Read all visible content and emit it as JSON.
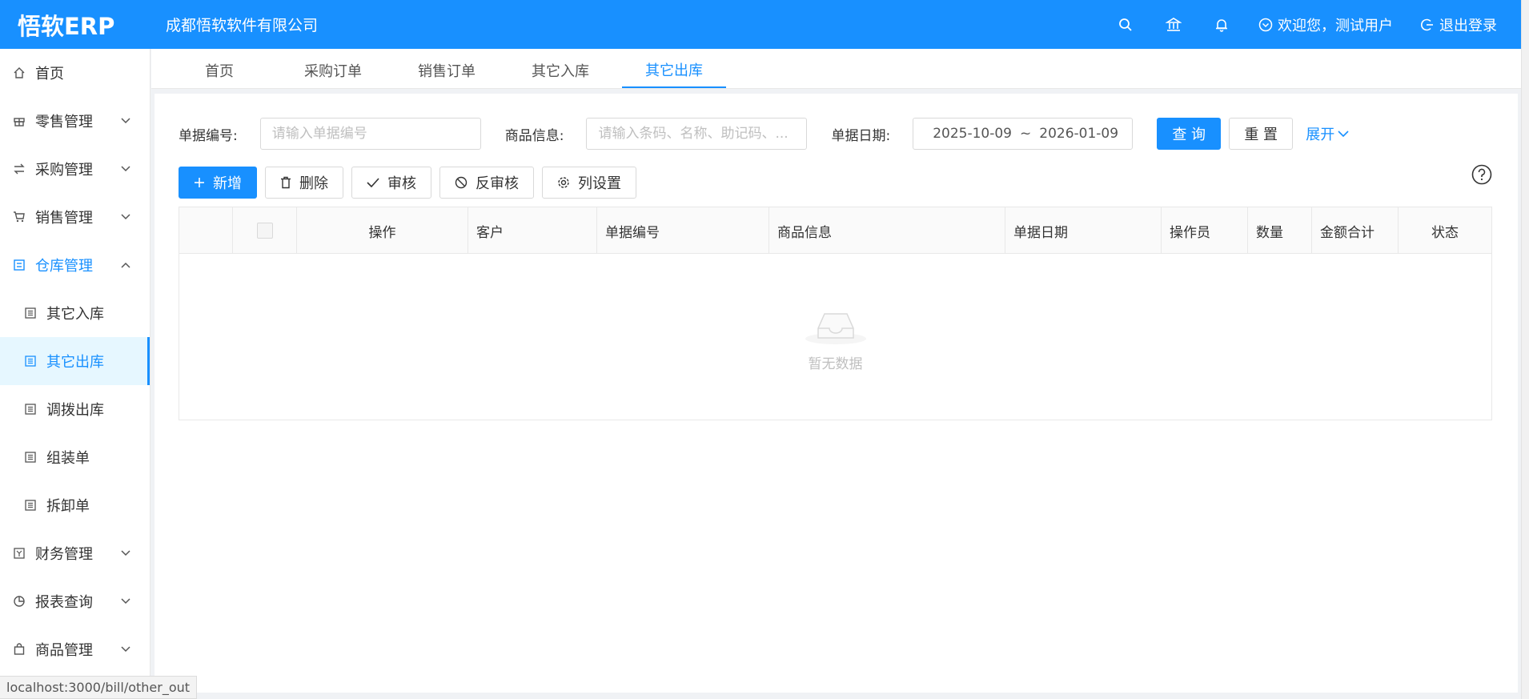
{
  "header": {
    "logo": "悟软ERP",
    "company": "成都悟软软件有限公司",
    "icons": [
      "search-icon",
      "bank-icon",
      "bell-icon"
    ],
    "welcome": "欢迎您，测试用户",
    "logout": "退出登录"
  },
  "sidebar": {
    "items": [
      {
        "label": "首页",
        "icon": "home-icon"
      },
      {
        "label": "零售管理",
        "icon": "gift-icon"
      },
      {
        "label": "采购管理",
        "icon": "swap-icon"
      },
      {
        "label": "销售管理",
        "icon": "cart-icon"
      },
      {
        "label": "仓库管理",
        "icon": "warehouse-icon"
      },
      {
        "label": "其它入库",
        "icon": "list-icon"
      },
      {
        "label": "其它出库",
        "icon": "list-icon"
      },
      {
        "label": "调拨出库",
        "icon": "list-icon"
      },
      {
        "label": "组装单",
        "icon": "list-icon"
      },
      {
        "label": "拆卸单",
        "icon": "list-icon"
      },
      {
        "label": "财务管理",
        "icon": "finance-icon"
      },
      {
        "label": "报表查询",
        "icon": "pie-icon"
      },
      {
        "label": "商品管理",
        "icon": "bag-icon"
      }
    ]
  },
  "tabs": [
    {
      "label": "首页"
    },
    {
      "label": "采购订单"
    },
    {
      "label": "销售订单"
    },
    {
      "label": "其它入库"
    },
    {
      "label": "其它出库"
    }
  ],
  "search": {
    "bill_no_label": "单据编号:",
    "bill_no_placeholder": "请输入单据编号",
    "goods_label": "商品信息:",
    "goods_placeholder": "请输入条码、名称、助记码、...",
    "date_label": "单据日期:",
    "date_start": "2025-10-09",
    "date_sep": "~",
    "date_end": "2026-01-09",
    "query": "查 询",
    "reset": "重 置",
    "expand": "展开"
  },
  "toolbar": {
    "add": "新增",
    "delete": "删除",
    "audit": "审核",
    "unaudit": "反审核",
    "columns": "列设置"
  },
  "table": {
    "columns": [
      "操作",
      "客户",
      "单据编号",
      "商品信息",
      "单据日期",
      "操作员",
      "数量",
      "金额合计",
      "状态"
    ],
    "empty_text": "暂无数据"
  },
  "status_url": "localhost:3000/bill/other_out",
  "colors": {
    "accent": "#1890ff"
  }
}
